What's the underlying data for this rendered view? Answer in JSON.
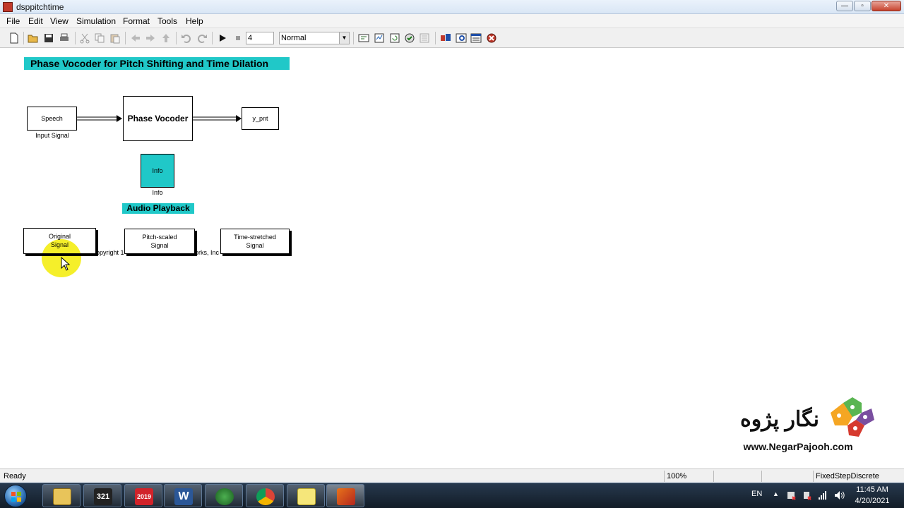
{
  "window": {
    "title": "dsppitchtime",
    "buttons": {
      "minimize": "—",
      "maximize": "▫",
      "close": "✕"
    }
  },
  "menu": [
    "File",
    "Edit",
    "View",
    "Simulation",
    "Format",
    "Tools",
    "Help"
  ],
  "toolbar": {
    "stop_time": "4",
    "sim_mode": "Normal"
  },
  "model": {
    "title": "Phase Vocoder for Pitch Shifting and Time Dilation",
    "blocks": {
      "speech": {
        "text": "Speech",
        "label": "Input Signal"
      },
      "vocoder": {
        "text": "Phase Vocoder"
      },
      "output": {
        "text": "y_pnt"
      },
      "info": {
        "text": "Info",
        "label": "Info"
      }
    },
    "audio_playback": {
      "title": "Audio Playback",
      "buttons": [
        {
          "line1": "Original",
          "line2": "Signal"
        },
        {
          "line1": "Pitch-scaled",
          "line2": "Signal"
        },
        {
          "line1": "Time-stretched",
          "line2": "Signal"
        }
      ]
    },
    "hidden_copyright_fragments": [
      "opyright 1",
      "orks, Inc"
    ],
    "colors": {
      "annotation_bg": "#20c8c8",
      "cursor_highlight": "#f5ef2a"
    }
  },
  "watermark": {
    "persian": "نگار پژوه",
    "url": "www.NegarPajooh.com"
  },
  "status": {
    "left": "Ready",
    "zoom": "100%",
    "solver": "FixedStepDiscrete"
  },
  "taskbar": {
    "apps": [
      "windows-explorer",
      "media-player-321",
      "solidworks-2019",
      "microsoft-word",
      "internet-download-manager",
      "google-chrome",
      "sticky-notes",
      "matlab"
    ],
    "sw_year": "2019",
    "app_321": "321",
    "word_letter": "W",
    "lang": "EN",
    "time": "11:45 AM",
    "date": "4/20/2021"
  }
}
